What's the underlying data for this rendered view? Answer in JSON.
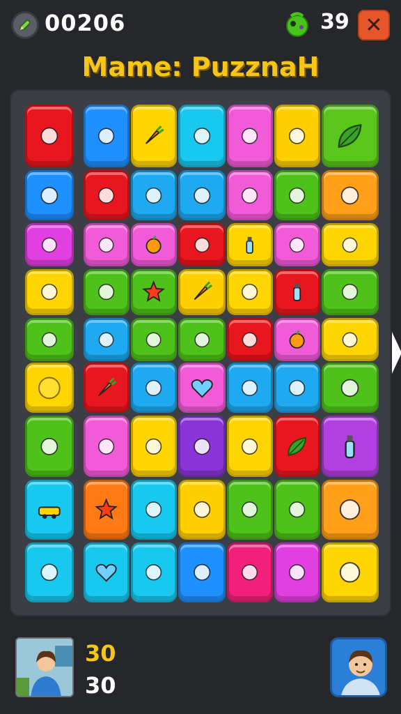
{
  "header": {
    "score": "00206",
    "gems": "39",
    "close_label": "✕",
    "title": "Mame: PuzznaH"
  },
  "board": {
    "tiles": [
      {
        "color": "#e8161e",
        "icon": "gamepad-icon"
      },
      {
        "color": "#1e90ff",
        "icon": "device-icon"
      },
      {
        "color": "#ffd500",
        "icon": "carrot-icon"
      },
      {
        "color": "#19c8ee",
        "icon": "squid-icon"
      },
      {
        "color": "#f25bd8",
        "icon": "paintbrush-icon"
      },
      {
        "color": "#ffcf00",
        "icon": "apple-icon"
      },
      {
        "color": "#5ac51b",
        "icon": "leaf-icon"
      },
      {
        "color": "#1e90ff",
        "icon": "bed-icon"
      },
      {
        "color": "#e8161e",
        "icon": "pepper-icon"
      },
      {
        "color": "#1ea9f0",
        "icon": "sock-icon"
      },
      {
        "color": "#1ea9f0",
        "icon": "pen-icon"
      },
      {
        "color": "#f25bd8",
        "icon": "feather-icon"
      },
      {
        "color": "#4ec21a",
        "icon": "capsule-icon"
      },
      {
        "color": "#ff9f1a",
        "icon": "tomato-icon"
      },
      {
        "color": "#e23fe0",
        "icon": "sock-icon"
      },
      {
        "color": "#f25bd8",
        "icon": "basket-icon"
      },
      {
        "color": "#f25bd8",
        "icon": "orange-icon"
      },
      {
        "color": "#e8161e",
        "icon": "jar-icon"
      },
      {
        "color": "#ffd500",
        "icon": "bottle-icon"
      },
      {
        "color": "#f25bd8",
        "icon": "flowerpot-icon"
      },
      {
        "color": "#ffd500",
        "icon": "cucumber-icon"
      },
      {
        "color": "#ffd500",
        "icon": "berry-icon"
      },
      {
        "color": "#4ec21a",
        "icon": "trowel-icon"
      },
      {
        "color": "#4ec21a",
        "icon": "star-icon"
      },
      {
        "color": "#ffcf00",
        "icon": "carrot-icon"
      },
      {
        "color": "#ffd500",
        "icon": "pepper-icon"
      },
      {
        "color": "#e8161e",
        "icon": "bottle-icon"
      },
      {
        "color": "#4ec21a",
        "icon": "radish-icon"
      },
      {
        "color": "#4ec21a",
        "icon": "lollipop-icon"
      },
      {
        "color": "#1ea9f0",
        "icon": "feather-icon"
      },
      {
        "color": "#4ec21a",
        "icon": "maple-leaf-icon"
      },
      {
        "color": "#4ec21a",
        "icon": "popcorn-icon"
      },
      {
        "color": "#e8161e",
        "icon": "plant-icon"
      },
      {
        "color": "#f25bd8",
        "icon": "orange-icon"
      },
      {
        "color": "#ffd500",
        "icon": "cake-icon"
      },
      {
        "color": "#ffd500",
        "icon": "lemon-icon"
      },
      {
        "color": "#e8161e",
        "icon": "carrot-icon"
      },
      {
        "color": "#1ea9f0",
        "icon": "bird-icon"
      },
      {
        "color": "#f25bd8",
        "icon": "heart-icon"
      },
      {
        "color": "#1ea9f0",
        "icon": "microphone-icon"
      },
      {
        "color": "#1ea9f0",
        "icon": "lantern-icon"
      },
      {
        "color": "#4ec21a",
        "icon": "hat-icon"
      },
      {
        "color": "#4ec21a",
        "icon": "bird-icon"
      },
      {
        "color": "#f25bd8",
        "icon": "wave-icon"
      },
      {
        "color": "#ffd500",
        "icon": "raspberry-icon"
      },
      {
        "color": "#8a35d8",
        "icon": "bear-icon"
      },
      {
        "color": "#ffd500",
        "icon": "bean-icon"
      },
      {
        "color": "#e8161e",
        "icon": "leaf-icon"
      },
      {
        "color": "#b23fe0",
        "icon": "bottle-icon"
      },
      {
        "color": "#19c8ee",
        "icon": "car-icon"
      },
      {
        "color": "#ff7a14",
        "icon": "star-icon"
      },
      {
        "color": "#19c8ee",
        "icon": "sailboat-icon"
      },
      {
        "color": "#ffcf00",
        "icon": "egg-icon"
      },
      {
        "color": "#4ec21a",
        "icon": "strawberry-icon"
      },
      {
        "color": "#4ec21a",
        "icon": "blueberry-icon"
      },
      {
        "color": "#ff9f1a",
        "icon": "nuts-icon"
      },
      {
        "color": "#19c8ee",
        "icon": "phone-icon"
      },
      {
        "color": "#19c8ee",
        "icon": "heart-icon"
      },
      {
        "color": "#19c8ee",
        "icon": "bone-icon"
      },
      {
        "color": "#1e90ff",
        "icon": "cookie-icon"
      },
      {
        "color": "#f2207a",
        "icon": "radio-icon"
      },
      {
        "color": "#e23fe0",
        "icon": "rose-icon"
      },
      {
        "color": "#ffd500",
        "icon": "frame-icon"
      }
    ]
  },
  "footer": {
    "stat_top": "30",
    "stat_bottom": "30"
  }
}
